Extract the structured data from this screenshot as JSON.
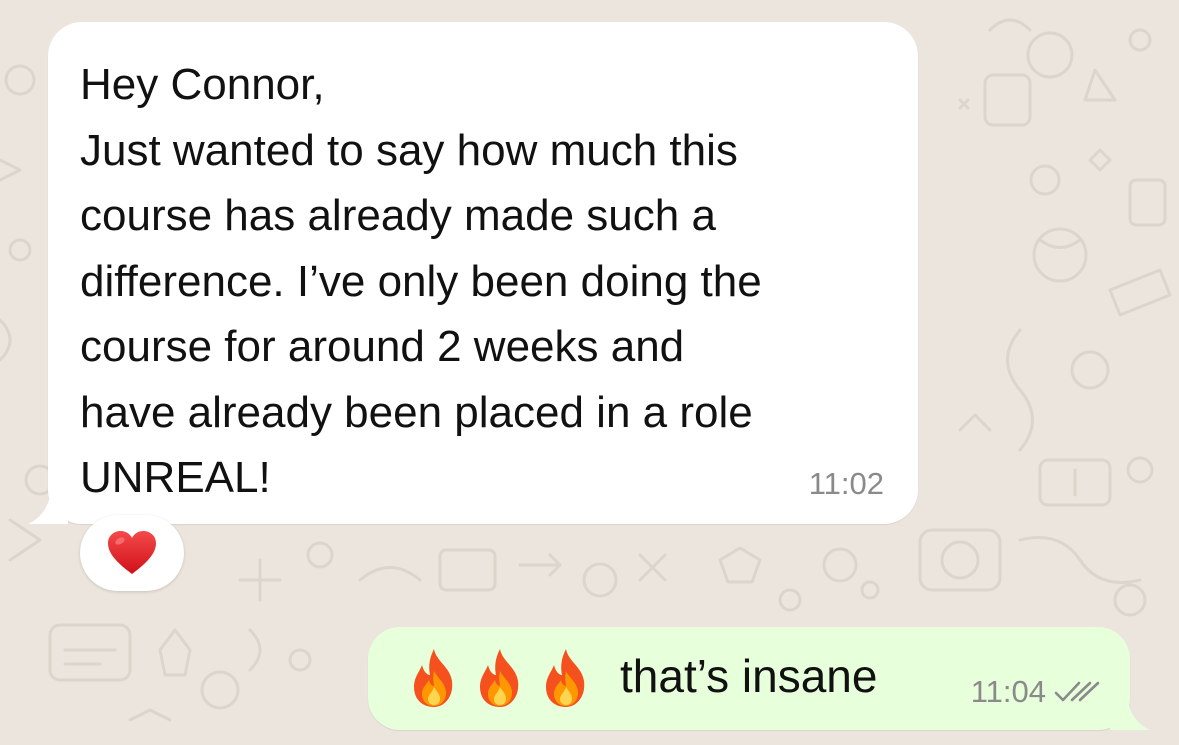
{
  "incoming_message": {
    "text": "Hey Connor,\nJust wanted to say how much this\ncourse has already made such a\ndifference. I’ve only been doing the\ncourse for around 2 weeks and\nhave already been placed in a role\nUNREAL!",
    "time": "11:02",
    "reaction": "heart-emoji"
  },
  "outgoing_message": {
    "emojis": [
      "fire-emoji",
      "fire-emoji",
      "fire-emoji"
    ],
    "text": "that’s insane",
    "time": "11:04",
    "status": "read-double-check-icon"
  },
  "colors": {
    "chat_background": "#ece5dd",
    "incoming_bubble": "#ffffff",
    "outgoing_bubble": "#e7ffdb",
    "timestamp": "#8a8a8a",
    "read_ticks": "#8a8a8a"
  }
}
